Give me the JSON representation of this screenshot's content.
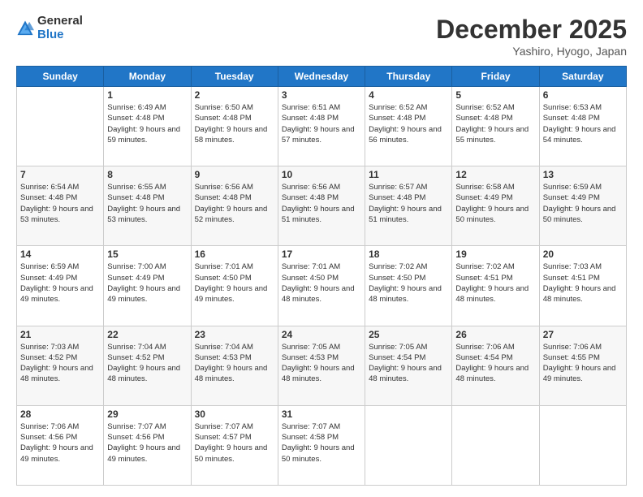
{
  "header": {
    "logo_general": "General",
    "logo_blue": "Blue",
    "month_title": "December 2025",
    "location": "Yashiro, Hyogo, Japan"
  },
  "weekdays": [
    "Sunday",
    "Monday",
    "Tuesday",
    "Wednesday",
    "Thursday",
    "Friday",
    "Saturday"
  ],
  "weeks": [
    [
      {
        "day": "",
        "sunrise": "",
        "sunset": "",
        "daylight": ""
      },
      {
        "day": "1",
        "sunrise": "Sunrise: 6:49 AM",
        "sunset": "Sunset: 4:48 PM",
        "daylight": "Daylight: 9 hours and 59 minutes."
      },
      {
        "day": "2",
        "sunrise": "Sunrise: 6:50 AM",
        "sunset": "Sunset: 4:48 PM",
        "daylight": "Daylight: 9 hours and 58 minutes."
      },
      {
        "day": "3",
        "sunrise": "Sunrise: 6:51 AM",
        "sunset": "Sunset: 4:48 PM",
        "daylight": "Daylight: 9 hours and 57 minutes."
      },
      {
        "day": "4",
        "sunrise": "Sunrise: 6:52 AM",
        "sunset": "Sunset: 4:48 PM",
        "daylight": "Daylight: 9 hours and 56 minutes."
      },
      {
        "day": "5",
        "sunrise": "Sunrise: 6:52 AM",
        "sunset": "Sunset: 4:48 PM",
        "daylight": "Daylight: 9 hours and 55 minutes."
      },
      {
        "day": "6",
        "sunrise": "Sunrise: 6:53 AM",
        "sunset": "Sunset: 4:48 PM",
        "daylight": "Daylight: 9 hours and 54 minutes."
      }
    ],
    [
      {
        "day": "7",
        "sunrise": "Sunrise: 6:54 AM",
        "sunset": "Sunset: 4:48 PM",
        "daylight": "Daylight: 9 hours and 53 minutes."
      },
      {
        "day": "8",
        "sunrise": "Sunrise: 6:55 AM",
        "sunset": "Sunset: 4:48 PM",
        "daylight": "Daylight: 9 hours and 53 minutes."
      },
      {
        "day": "9",
        "sunrise": "Sunrise: 6:56 AM",
        "sunset": "Sunset: 4:48 PM",
        "daylight": "Daylight: 9 hours and 52 minutes."
      },
      {
        "day": "10",
        "sunrise": "Sunrise: 6:56 AM",
        "sunset": "Sunset: 4:48 PM",
        "daylight": "Daylight: 9 hours and 51 minutes."
      },
      {
        "day": "11",
        "sunrise": "Sunrise: 6:57 AM",
        "sunset": "Sunset: 4:48 PM",
        "daylight": "Daylight: 9 hours and 51 minutes."
      },
      {
        "day": "12",
        "sunrise": "Sunrise: 6:58 AM",
        "sunset": "Sunset: 4:49 PM",
        "daylight": "Daylight: 9 hours and 50 minutes."
      },
      {
        "day": "13",
        "sunrise": "Sunrise: 6:59 AM",
        "sunset": "Sunset: 4:49 PM",
        "daylight": "Daylight: 9 hours and 50 minutes."
      }
    ],
    [
      {
        "day": "14",
        "sunrise": "Sunrise: 6:59 AM",
        "sunset": "Sunset: 4:49 PM",
        "daylight": "Daylight: 9 hours and 49 minutes."
      },
      {
        "day": "15",
        "sunrise": "Sunrise: 7:00 AM",
        "sunset": "Sunset: 4:49 PM",
        "daylight": "Daylight: 9 hours and 49 minutes."
      },
      {
        "day": "16",
        "sunrise": "Sunrise: 7:01 AM",
        "sunset": "Sunset: 4:50 PM",
        "daylight": "Daylight: 9 hours and 49 minutes."
      },
      {
        "day": "17",
        "sunrise": "Sunrise: 7:01 AM",
        "sunset": "Sunset: 4:50 PM",
        "daylight": "Daylight: 9 hours and 48 minutes."
      },
      {
        "day": "18",
        "sunrise": "Sunrise: 7:02 AM",
        "sunset": "Sunset: 4:50 PM",
        "daylight": "Daylight: 9 hours and 48 minutes."
      },
      {
        "day": "19",
        "sunrise": "Sunrise: 7:02 AM",
        "sunset": "Sunset: 4:51 PM",
        "daylight": "Daylight: 9 hours and 48 minutes."
      },
      {
        "day": "20",
        "sunrise": "Sunrise: 7:03 AM",
        "sunset": "Sunset: 4:51 PM",
        "daylight": "Daylight: 9 hours and 48 minutes."
      }
    ],
    [
      {
        "day": "21",
        "sunrise": "Sunrise: 7:03 AM",
        "sunset": "Sunset: 4:52 PM",
        "daylight": "Daylight: 9 hours and 48 minutes."
      },
      {
        "day": "22",
        "sunrise": "Sunrise: 7:04 AM",
        "sunset": "Sunset: 4:52 PM",
        "daylight": "Daylight: 9 hours and 48 minutes."
      },
      {
        "day": "23",
        "sunrise": "Sunrise: 7:04 AM",
        "sunset": "Sunset: 4:53 PM",
        "daylight": "Daylight: 9 hours and 48 minutes."
      },
      {
        "day": "24",
        "sunrise": "Sunrise: 7:05 AM",
        "sunset": "Sunset: 4:53 PM",
        "daylight": "Daylight: 9 hours and 48 minutes."
      },
      {
        "day": "25",
        "sunrise": "Sunrise: 7:05 AM",
        "sunset": "Sunset: 4:54 PM",
        "daylight": "Daylight: 9 hours and 48 minutes."
      },
      {
        "day": "26",
        "sunrise": "Sunrise: 7:06 AM",
        "sunset": "Sunset: 4:54 PM",
        "daylight": "Daylight: 9 hours and 48 minutes."
      },
      {
        "day": "27",
        "sunrise": "Sunrise: 7:06 AM",
        "sunset": "Sunset: 4:55 PM",
        "daylight": "Daylight: 9 hours and 49 minutes."
      }
    ],
    [
      {
        "day": "28",
        "sunrise": "Sunrise: 7:06 AM",
        "sunset": "Sunset: 4:56 PM",
        "daylight": "Daylight: 9 hours and 49 minutes."
      },
      {
        "day": "29",
        "sunrise": "Sunrise: 7:07 AM",
        "sunset": "Sunset: 4:56 PM",
        "daylight": "Daylight: 9 hours and 49 minutes."
      },
      {
        "day": "30",
        "sunrise": "Sunrise: 7:07 AM",
        "sunset": "Sunset: 4:57 PM",
        "daylight": "Daylight: 9 hours and 50 minutes."
      },
      {
        "day": "31",
        "sunrise": "Sunrise: 7:07 AM",
        "sunset": "Sunset: 4:58 PM",
        "daylight": "Daylight: 9 hours and 50 minutes."
      },
      {
        "day": "",
        "sunrise": "",
        "sunset": "",
        "daylight": ""
      },
      {
        "day": "",
        "sunrise": "",
        "sunset": "",
        "daylight": ""
      },
      {
        "day": "",
        "sunrise": "",
        "sunset": "",
        "daylight": ""
      }
    ]
  ]
}
